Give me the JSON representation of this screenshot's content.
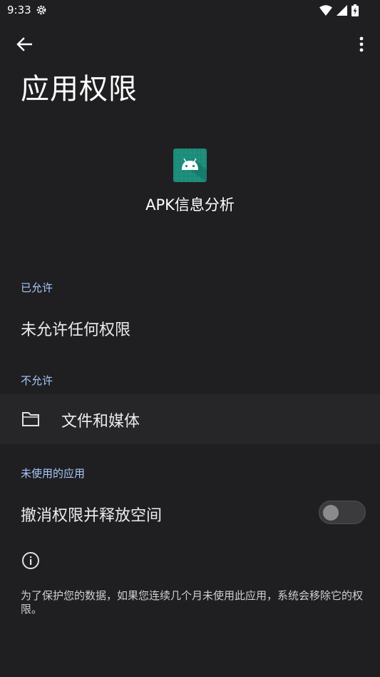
{
  "status_bar": {
    "time": "9:33"
  },
  "toolbar": {
    "title": "应用权限"
  },
  "app": {
    "name": "APK信息分析"
  },
  "sections": {
    "allowed": {
      "label": "已允许",
      "empty_text": "未允许任何权限"
    },
    "denied": {
      "label": "不允许",
      "items": [
        {
          "label": "文件和媒体",
          "icon": "folder-icon"
        }
      ]
    },
    "unused_apps": {
      "label": "未使用的应用",
      "toggle_label": "撤消权限并释放空间",
      "toggle_on": false,
      "info_text": "为了保护您的数据，如果您连续几个月未使用此应用，系统会移除它的权限。"
    }
  },
  "colors": {
    "background": "#1f1f21",
    "accent_label": "#a8c7fa",
    "app_icon": "#1d8a78"
  }
}
